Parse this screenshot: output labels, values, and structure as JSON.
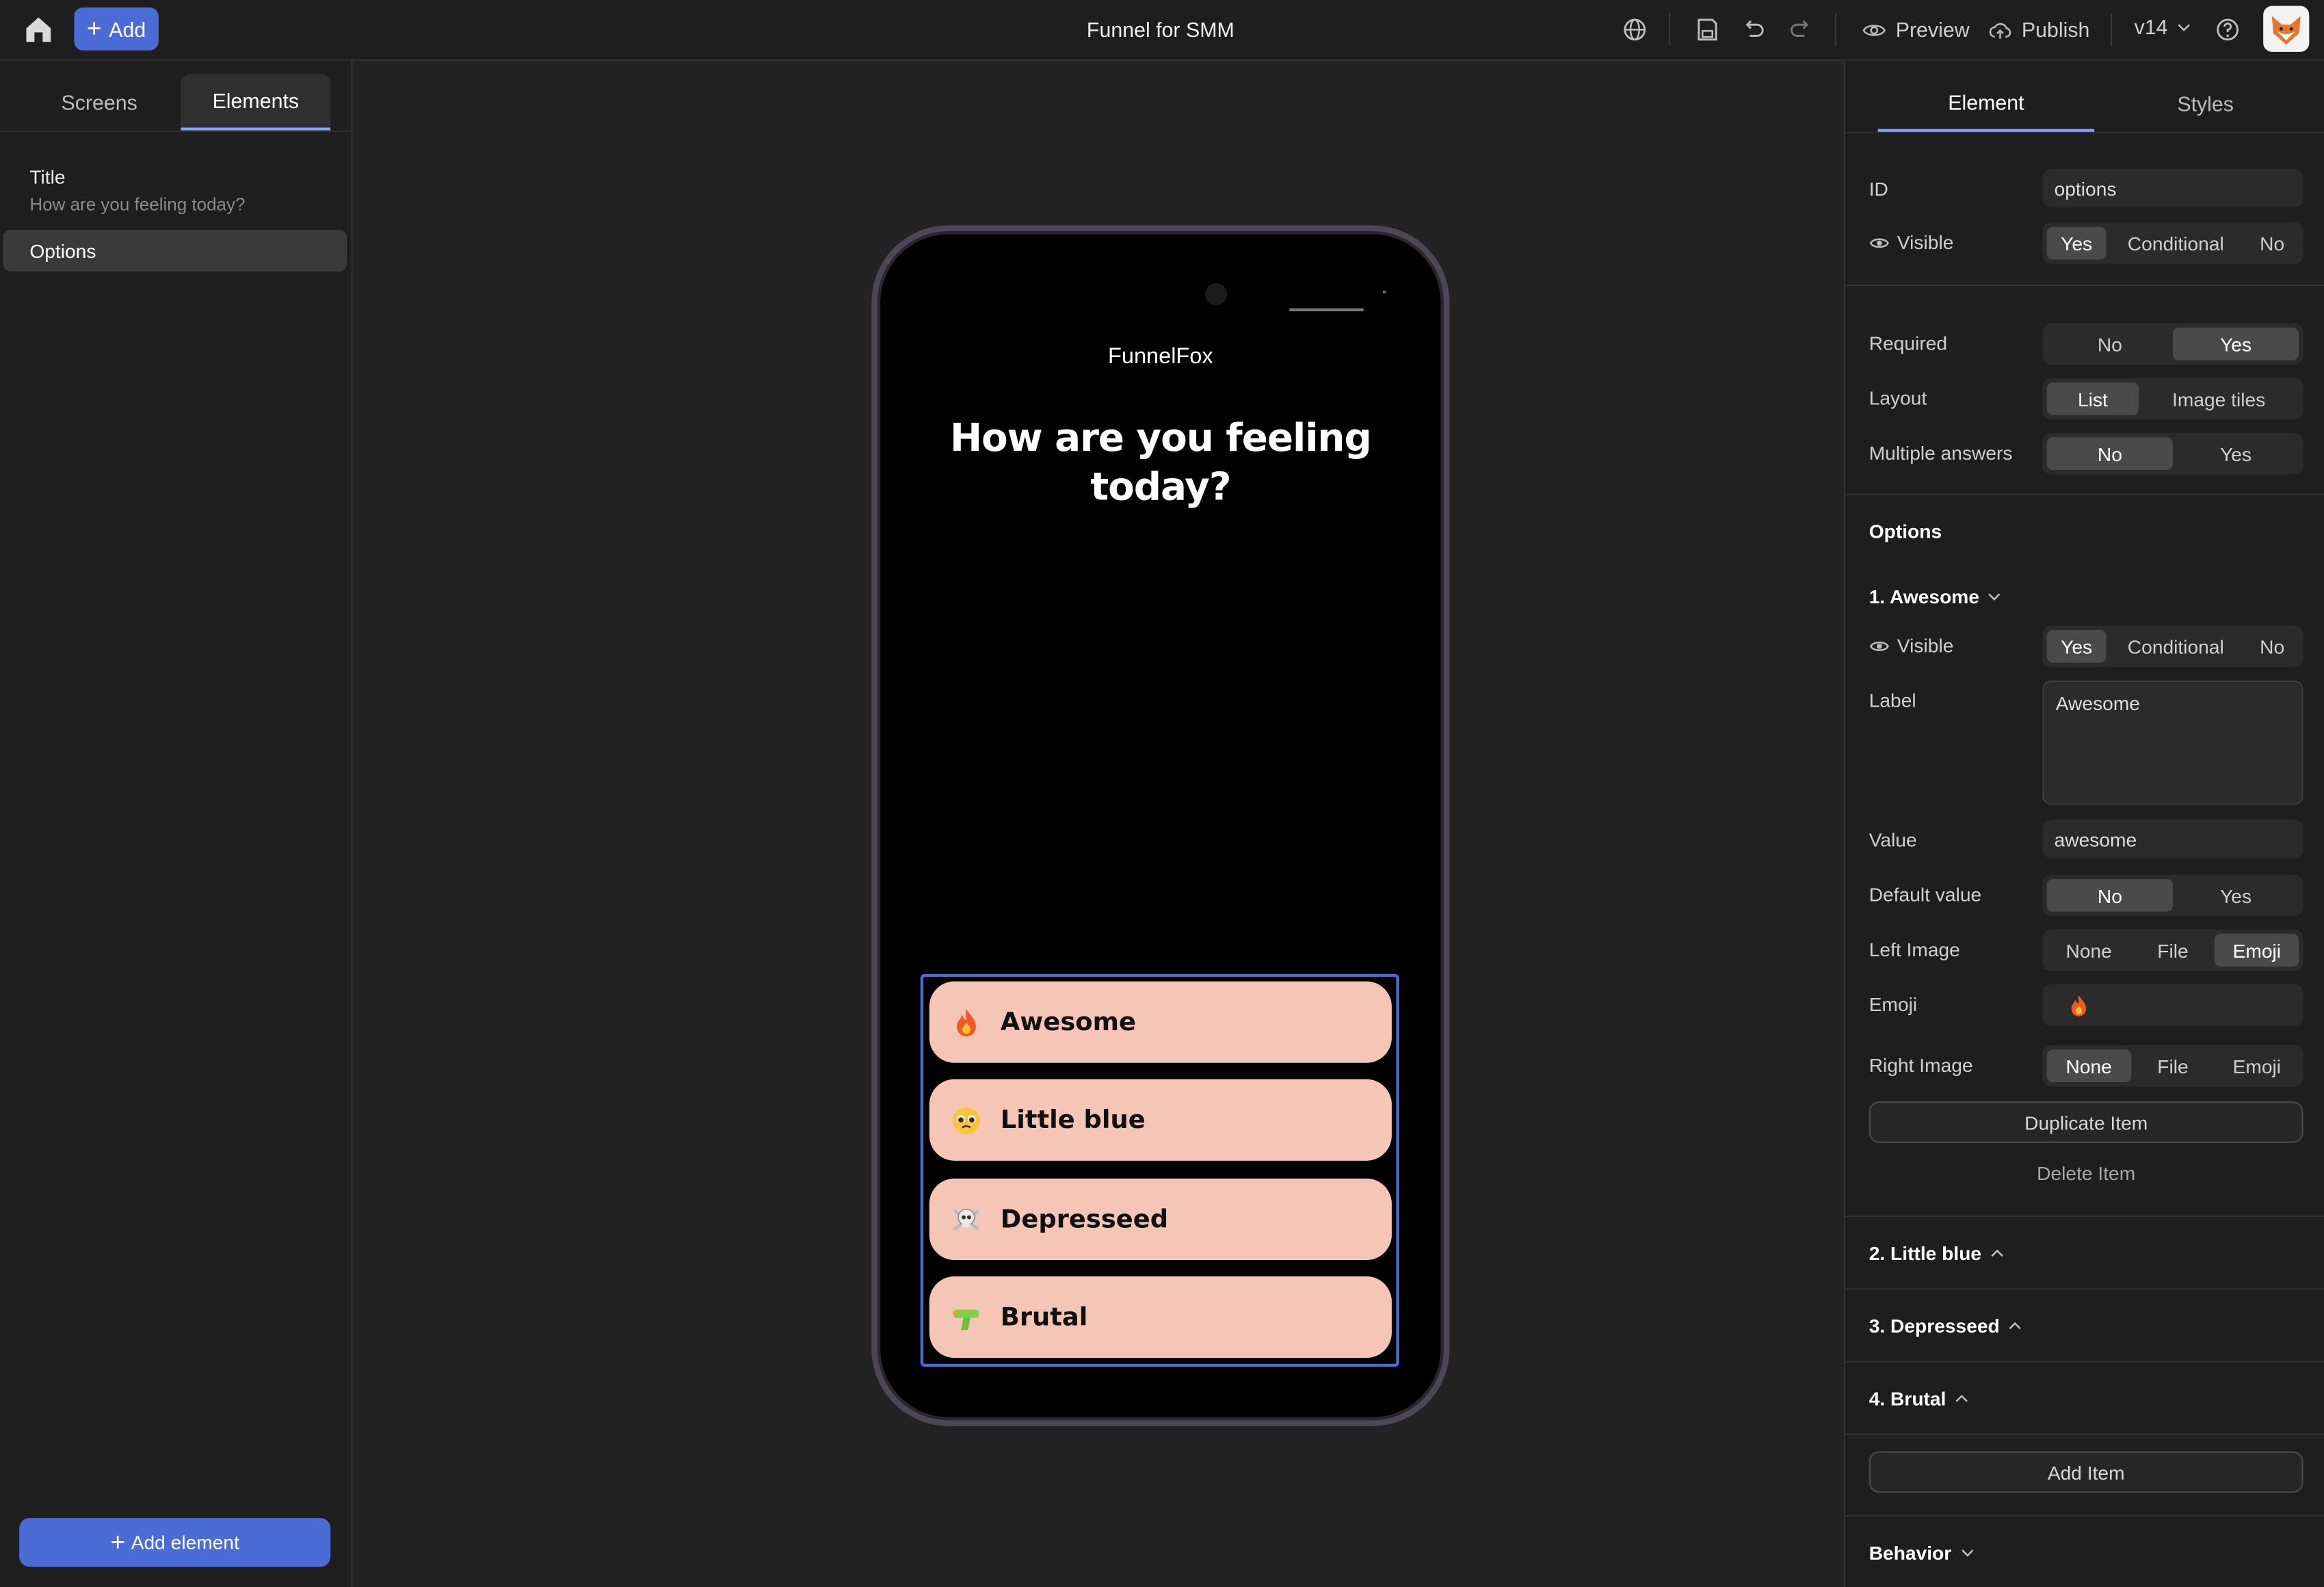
{
  "topbar": {
    "add_label": "Add",
    "title": "Funnel for SMM",
    "preview_label": "Preview",
    "publish_label": "Publish",
    "version": "v14"
  },
  "left": {
    "tabs": [
      "Screens",
      "Elements"
    ],
    "active_tab": "Elements",
    "elements": [
      {
        "label": "Title",
        "sub": "How are you feeling today?"
      },
      {
        "label": "Options"
      }
    ],
    "add_element_label": "Add element"
  },
  "phone": {
    "brand": "FunnelFox",
    "question": "How are you feeling today?",
    "options": [
      {
        "emoji": "🔥",
        "label": "Awesome"
      },
      {
        "emoji": "🥺",
        "label": "Little blue"
      },
      {
        "emoji": "☠️",
        "label": "Depresseed"
      },
      {
        "emoji": "🔫",
        "label": "Brutal"
      }
    ],
    "option_bg": "#f5c6b6"
  },
  "right": {
    "tabs": [
      "Element",
      "Styles"
    ],
    "active_tab": "Element",
    "id_label": "ID",
    "id_value": "options",
    "visible_label": "Visible",
    "visible_options": [
      "Yes",
      "Conditional",
      "No"
    ],
    "visible_selected": "Yes",
    "required_label": "Required",
    "required_options": [
      "No",
      "Yes"
    ],
    "required_selected": "Yes",
    "layout_label": "Layout",
    "layout_options": [
      "List",
      "Image tiles"
    ],
    "layout_selected": "List",
    "multiple_label": "Multiple answers",
    "multiple_options": [
      "No",
      "Yes"
    ],
    "multiple_selected": "No",
    "options_heading": "Options",
    "item1": {
      "heading": "1. Awesome",
      "visible_label": "Visible",
      "visible_options": [
        "Yes",
        "Conditional",
        "No"
      ],
      "visible_selected": "Yes",
      "label_label": "Label",
      "label_value": "Awesome",
      "value_label": "Value",
      "value_value": "awesome",
      "default_label": "Default value",
      "default_options": [
        "No",
        "Yes"
      ],
      "default_selected": "No",
      "left_image_label": "Left Image",
      "left_image_options": [
        "None",
        "File",
        "Emoji"
      ],
      "left_image_selected": "Emoji",
      "emoji_label": "Emoji",
      "emoji_value": "🔥",
      "right_image_label": "Right Image",
      "right_image_options": [
        "None",
        "File",
        "Emoji"
      ],
      "right_image_selected": "None",
      "duplicate_label": "Duplicate Item",
      "delete_label": "Delete Item"
    },
    "collapsed_items": [
      "2. Little blue",
      "3. Depresseed",
      "4. Brutal"
    ],
    "add_item_label": "Add Item",
    "behavior_label": "Behavior"
  },
  "colors": {
    "accent": "#4b6bd6",
    "panel": "#1e1e1e",
    "canvas": "#232323"
  }
}
